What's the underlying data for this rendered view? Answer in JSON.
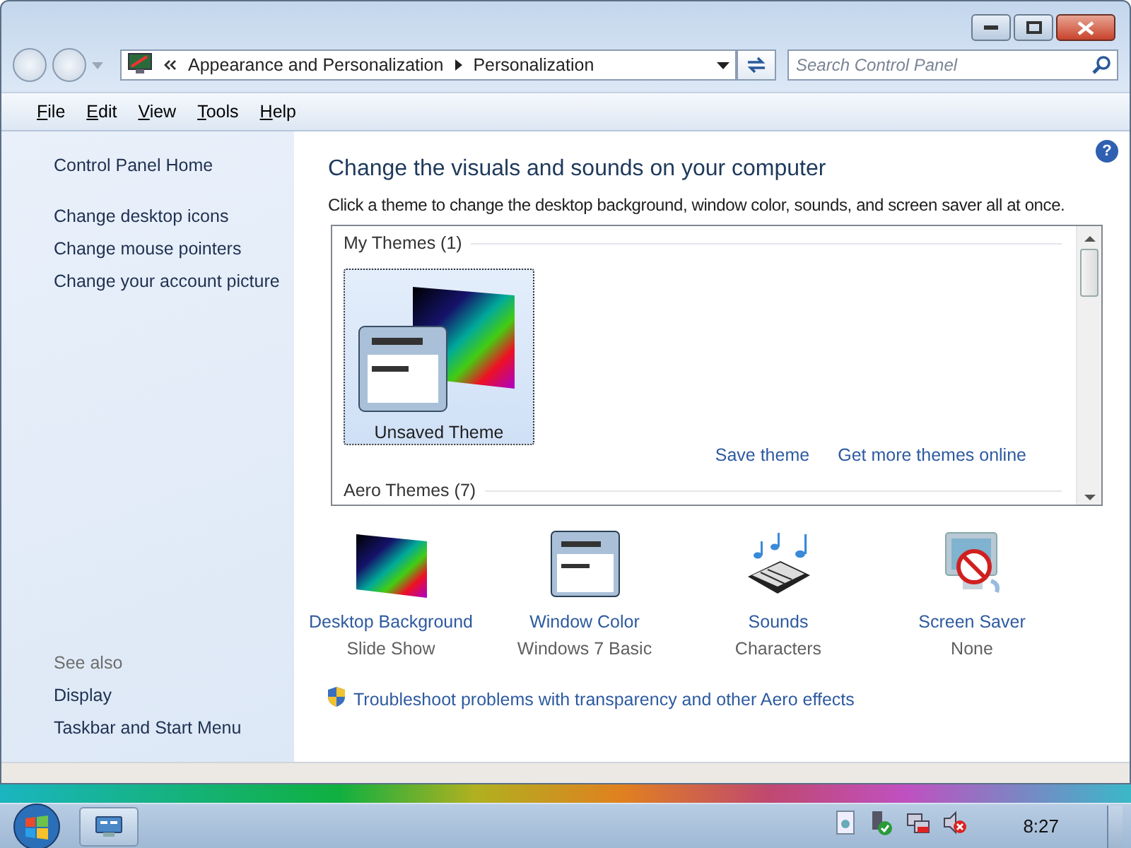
{
  "address": {
    "crumbs": [
      "Appearance and Personalization",
      "Personalization"
    ]
  },
  "search": {
    "placeholder": "Search Control Panel"
  },
  "menu": [
    "File",
    "Edit",
    "View",
    "Tools",
    "Help"
  ],
  "sidebar": {
    "links": [
      "Control Panel Home",
      "Change desktop icons",
      "Change mouse pointers",
      "Change your account picture"
    ],
    "see_also_heading": "See also",
    "see_also": [
      "Display",
      "Taskbar and Start Menu"
    ]
  },
  "help_button": "?",
  "heading": "Change the visuals and sounds on your computer",
  "description": "Click a theme to change the desktop background, window color, sounds, and screen saver all at once.",
  "themes": {
    "groups": [
      {
        "title": "My Themes (1)",
        "items": [
          {
            "name": "Unsaved Theme",
            "selected": true
          }
        ]
      },
      {
        "title": "Aero Themes (7)"
      }
    ],
    "links": [
      "Save theme",
      "Get more themes online"
    ]
  },
  "settings": [
    {
      "kind": "background",
      "label": "Desktop Background",
      "value": "Slide Show"
    },
    {
      "kind": "color",
      "label": "Window Color",
      "value": "Windows 7 Basic"
    },
    {
      "kind": "sounds",
      "label": "Sounds",
      "value": "Characters"
    },
    {
      "kind": "screensaver",
      "label": "Screen Saver",
      "value": "None"
    }
  ],
  "troubleshoot": "Troubleshoot problems with transparency and other Aero effects",
  "taskbar": {
    "clock": "8:27"
  }
}
